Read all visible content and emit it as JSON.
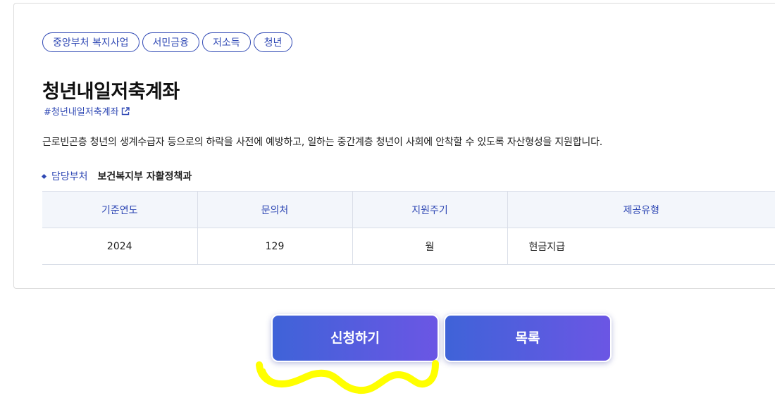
{
  "tags": [
    "중앙부처 복지사업",
    "서민금융",
    "저소득",
    "청년"
  ],
  "title": "청년내일저축계좌",
  "hashtag": "#청년내일저축계좌",
  "description": "근로빈곤층 청년의 생계수급자 등으로의 하락을 사전에 예방하고, 일하는 중간계층 청년이 사회에 안착할 수 있도록 자산형성을 지원합니다.",
  "department": {
    "label": "담당부처",
    "value": "보건복지부 자활정책과"
  },
  "table": {
    "headers": [
      "기준연도",
      "문의처",
      "지원주기",
      "제공유형"
    ],
    "row": [
      "2024",
      "129",
      "월",
      "현금지급"
    ]
  },
  "buttons": {
    "apply": "신청하기",
    "list": "목록"
  },
  "colors": {
    "accent": "#2f48b4",
    "button_gradient_start": "#3f63d8",
    "button_gradient_end": "#6b56e4",
    "scribble": "#ffff00"
  },
  "icons": {
    "hashtag_link": "external-link-icon"
  }
}
